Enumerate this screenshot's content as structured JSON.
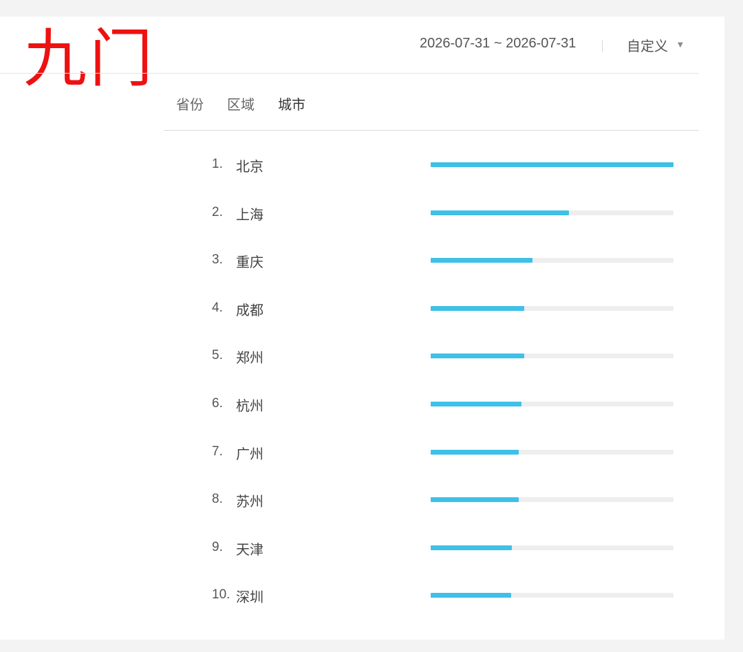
{
  "logo": {
    "text": "九门"
  },
  "header": {
    "date_range": "2026-07-31 ~ 2026-07-31",
    "preset_label": "自定义",
    "preset_icon": "caret-down-icon"
  },
  "tabs": [
    {
      "label": "省份",
      "active": false
    },
    {
      "label": "区域",
      "active": false
    },
    {
      "label": "城市",
      "active": true
    }
  ],
  "colors": {
    "bar_fill": "#3fc0e6",
    "bar_track": "#eeeeee",
    "logo": "#ee1111"
  },
  "ranking": [
    {
      "rank": "1.",
      "city": "北京",
      "level": 1.0
    },
    {
      "rank": "2.",
      "city": "上海",
      "level": 0.57
    },
    {
      "rank": "3.",
      "city": "重庆",
      "level": 0.42
    },
    {
      "rank": "4.",
      "city": "成都",
      "level": 0.385
    },
    {
      "rank": "5.",
      "city": "郑州",
      "level": 0.385
    },
    {
      "rank": "6.",
      "city": "杭州",
      "level": 0.375
    },
    {
      "rank": "7.",
      "city": "广州",
      "level": 0.362
    },
    {
      "rank": "8.",
      "city": "苏州",
      "level": 0.362
    },
    {
      "rank": "9.",
      "city": "天津",
      "level": 0.335
    },
    {
      "rank": "10.",
      "city": "深圳",
      "level": 0.332
    }
  ]
}
